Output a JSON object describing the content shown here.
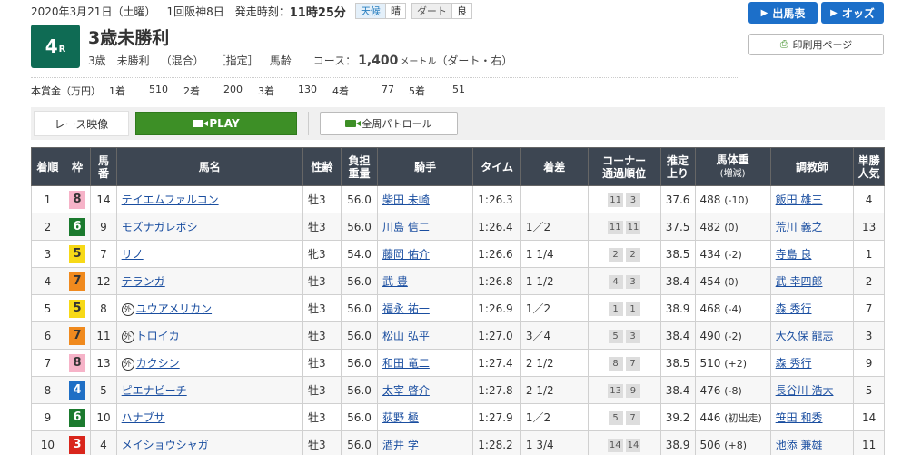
{
  "header": {
    "date": "2020年3月21日（土曜）",
    "meeting": "1回阪神8日",
    "start_label": "発走時刻：",
    "start_time": "11時25分",
    "weather_label": "天候",
    "weather_value": "晴",
    "track_label": "ダート",
    "track_value": "良"
  },
  "race": {
    "number": "4",
    "number_suffix": "R",
    "title": "3歳未勝利",
    "age": "3歳",
    "class": "未勝利",
    "mix": "（混合）",
    "designation": "［指定］",
    "weight_rule": "馬齢",
    "course_label": "コース：",
    "distance": "1,400",
    "distance_unit": "メートル",
    "surface": "（ダート・右）"
  },
  "buttons": {
    "entries": "出馬表",
    "odds": "オッズ",
    "print": "印刷用ページ"
  },
  "prize": {
    "label": "本賞金（万円）",
    "items": [
      {
        "rank": "1着",
        "amount": "510"
      },
      {
        "rank": "2着",
        "amount": "200"
      },
      {
        "rank": "3着",
        "amount": "130"
      },
      {
        "rank": "4着",
        "amount": "77"
      },
      {
        "rank": "5着",
        "amount": "51"
      }
    ]
  },
  "video": {
    "label": "レース映像",
    "play": "PLAY",
    "patrol": "全周パトロール"
  },
  "table": {
    "headers": {
      "rank": "着順",
      "waku": "枠",
      "num_1": "馬",
      "num_2": "番",
      "horse": "馬名",
      "sex_age": "性齢",
      "burden_1": "負担",
      "burden_2": "重量",
      "jockey": "騎手",
      "time": "タイム",
      "margin": "着差",
      "corner_1": "コーナー",
      "corner_2": "通過順位",
      "last_1": "推定",
      "last_2": "上り",
      "weight_1": "馬体重",
      "weight_2": "(増減)",
      "trainer": "調教師",
      "pop_1": "単勝",
      "pop_2": "人気"
    },
    "rows": [
      {
        "rank": "1",
        "waku": "8",
        "num": "14",
        "foreign": "",
        "horse": "テイエムファルコン",
        "sex_age": "牡3",
        "burden": "56.0",
        "jockey": "柴田 未崎",
        "time": "1:26.3",
        "margin": "",
        "c1": "11",
        "c2": "3",
        "last": "37.6",
        "weight": "488",
        "diff": "(-10)",
        "trainer": "飯田 雄三",
        "pop": "4"
      },
      {
        "rank": "2",
        "waku": "6",
        "num": "9",
        "foreign": "",
        "horse": "モズナガレボシ",
        "sex_age": "牡3",
        "burden": "56.0",
        "jockey": "川島 信二",
        "time": "1:26.4",
        "margin": "1／2",
        "c1": "11",
        "c2": "11",
        "last": "37.5",
        "weight": "482",
        "diff": "(0)",
        "trainer": "荒川 義之",
        "pop": "13"
      },
      {
        "rank": "3",
        "waku": "5",
        "num": "7",
        "foreign": "",
        "horse": "リノ",
        "sex_age": "牝3",
        "burden": "54.0",
        "jockey": "藤岡 佑介",
        "time": "1:26.6",
        "margin": "1 1/4",
        "c1": "2",
        "c2": "2",
        "last": "38.5",
        "weight": "434",
        "diff": "(-2)",
        "trainer": "寺島 良",
        "pop": "1"
      },
      {
        "rank": "4",
        "waku": "7",
        "num": "12",
        "foreign": "",
        "horse": "テランガ",
        "sex_age": "牡3",
        "burden": "56.0",
        "jockey": "武 豊",
        "time": "1:26.8",
        "margin": "1 1/2",
        "c1": "4",
        "c2": "3",
        "last": "38.4",
        "weight": "454",
        "diff": "(0)",
        "trainer": "武 幸四郎",
        "pop": "2"
      },
      {
        "rank": "5",
        "waku": "5",
        "num": "8",
        "foreign": "外",
        "horse": "ユウアメリカン",
        "sex_age": "牡3",
        "burden": "56.0",
        "jockey": "福永 祐一",
        "time": "1:26.9",
        "margin": "1／2",
        "c1": "1",
        "c2": "1",
        "last": "38.9",
        "weight": "468",
        "diff": "(-4)",
        "trainer": "森 秀行",
        "pop": "7"
      },
      {
        "rank": "6",
        "waku": "7",
        "num": "11",
        "foreign": "外",
        "horse": "トロイカ",
        "sex_age": "牡3",
        "burden": "56.0",
        "jockey": "松山 弘平",
        "time": "1:27.0",
        "margin": "3／4",
        "c1": "5",
        "c2": "3",
        "last": "38.4",
        "weight": "490",
        "diff": "(-2)",
        "trainer": "大久保 龍志",
        "pop": "3"
      },
      {
        "rank": "7",
        "waku": "8",
        "num": "13",
        "foreign": "外",
        "horse": "カクシン",
        "sex_age": "牡3",
        "burden": "56.0",
        "jockey": "和田 竜二",
        "time": "1:27.4",
        "margin": "2 1/2",
        "c1": "8",
        "c2": "7",
        "last": "38.5",
        "weight": "510",
        "diff": "(+2)",
        "trainer": "森 秀行",
        "pop": "9"
      },
      {
        "rank": "8",
        "waku": "4",
        "num": "5",
        "foreign": "",
        "horse": "ピエナビーチ",
        "sex_age": "牡3",
        "burden": "56.0",
        "jockey": "太宰 啓介",
        "time": "1:27.8",
        "margin": "2 1/2",
        "c1": "13",
        "c2": "9",
        "last": "38.4",
        "weight": "476",
        "diff": "(-8)",
        "trainer": "長谷川 浩大",
        "pop": "5"
      },
      {
        "rank": "9",
        "waku": "6",
        "num": "10",
        "foreign": "",
        "horse": "ハナブサ",
        "sex_age": "牡3",
        "burden": "56.0",
        "jockey": "荻野 極",
        "time": "1:27.9",
        "margin": "1／2",
        "c1": "5",
        "c2": "7",
        "last": "39.2",
        "weight": "446",
        "diff": "(初出走)",
        "trainer": "笹田 和秀",
        "pop": "14"
      },
      {
        "rank": "10",
        "waku": "3",
        "num": "4",
        "foreign": "",
        "horse": "メイショウシャガ",
        "sex_age": "牡3",
        "burden": "56.0",
        "jockey": "酒井 学",
        "time": "1:28.2",
        "margin": "1 3/4",
        "c1": "14",
        "c2": "14",
        "last": "38.9",
        "weight": "506",
        "diff": "(+8)",
        "trainer": "池添 兼雄",
        "pop": "11"
      }
    ]
  }
}
